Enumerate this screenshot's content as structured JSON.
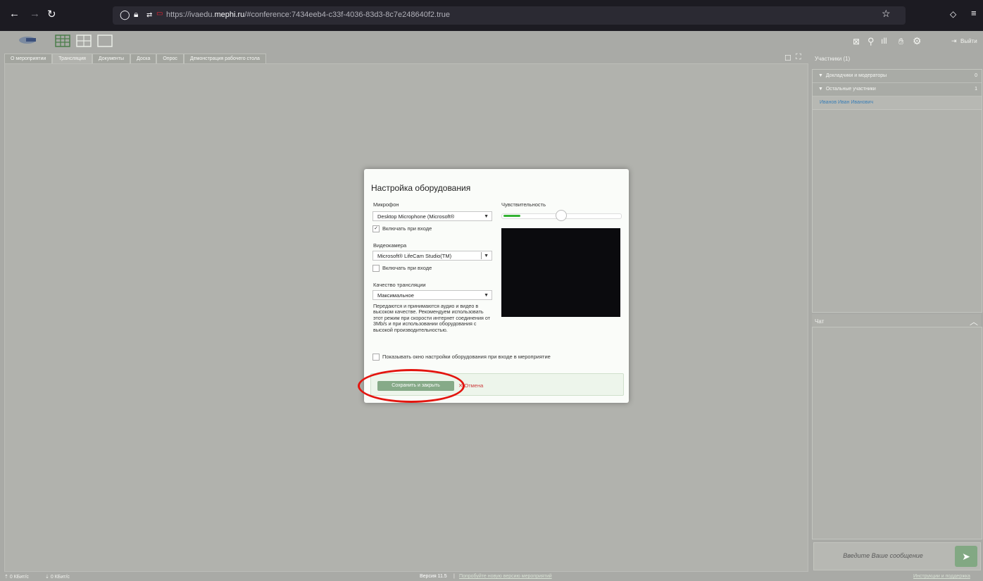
{
  "browser": {
    "url_prefix": "https://ivaedu.",
    "url_domain": "mephi.ru",
    "url_suffix": "/#conference:7434eeb4-c33f-4036-83d3-8c7e248640f2.true"
  },
  "topbar": {
    "logout_label": "Выйти"
  },
  "tabs": [
    {
      "label": "О мероприятии"
    },
    {
      "label": "Трансляция"
    },
    {
      "label": "Документы"
    },
    {
      "label": "Доска"
    },
    {
      "label": "Опрос"
    },
    {
      "label": "Демонстрация рабочего стола"
    }
  ],
  "participants": {
    "title": "Участники (1)",
    "groups": [
      {
        "label": "Докладчики и модераторы",
        "count": "0"
      },
      {
        "label": "Остальные участники",
        "count": "1"
      }
    ],
    "people": [
      "Иванов Иван Иванович"
    ]
  },
  "chat": {
    "title": "Чат",
    "placeholder": "Введите Ваше сообщение"
  },
  "footer": {
    "mic_rate": "0 КБит/с",
    "down_rate": "0 КБит/с",
    "version": "Версия 11.5",
    "sep": "|",
    "try_new": "Попробуйте новую версию мероприятий",
    "help": "Инструкции и поддержка"
  },
  "dialog": {
    "title": "Настройка оборудования",
    "mic_label": "Микрофон",
    "mic_value": "Desktop Microphone (Microsoft®",
    "mic_on_entry": "Включать при входе",
    "cam_label": "Видеокамера",
    "cam_value": "Microsoft® LifeCam Studio(TM)",
    "cam_on_entry": "Включать при входе",
    "quality_label": "Качество трансляции",
    "quality_value": "Максимальное",
    "quality_desc": "Передаются и принимаются аудио и видео в высоком качестве. Рекомендуем использовать этот режим при скорости интернет соединения от 3Mb/s и при использовании оборудования с высокой производительностью.",
    "sensitivity_label": "Чувствительность",
    "sensitivity_level": 0.5,
    "mic_level": 0.15,
    "show_on_entry": "Показывать окно настройки оборудования при входе в мероприятие",
    "save_label": "Сохранить и закрыть",
    "cancel_label": "Отмена",
    "mic_checked": true,
    "cam_checked": false,
    "show_checked": false
  },
  "colors": {
    "accent": "#86aa88",
    "annotation": "#e3150f"
  }
}
